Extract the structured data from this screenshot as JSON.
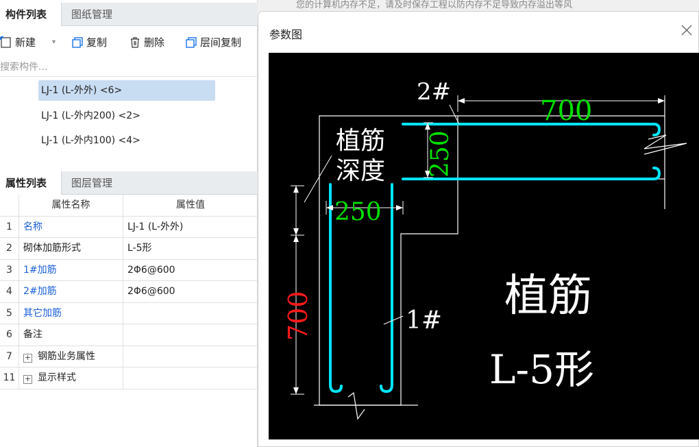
{
  "notice": "您的计算机内存不足，请及时保存工程以防内存不足导致内存溢出等风",
  "component_panel": {
    "tabs": [
      {
        "label": "构件列表",
        "active": true
      },
      {
        "label": "图纸管理",
        "active": false
      }
    ],
    "toolbar": {
      "new_label": "新建",
      "copy_label": "复制",
      "delete_label": "删除",
      "floor_copy_label": "层间复制"
    },
    "search_placeholder": "搜索构件...",
    "items": [
      {
        "label": "LJ-1 (L-外外)  <6>",
        "selected": true
      },
      {
        "label": "LJ-1 (L-外内200)  <2>",
        "selected": false
      },
      {
        "label": "LJ-1 (L-外内100)  <4>",
        "selected": false
      }
    ]
  },
  "property_panel": {
    "tabs": [
      {
        "label": "属性列表",
        "active": true
      },
      {
        "label": "图层管理",
        "active": false
      }
    ],
    "headers": {
      "name": "属性名称",
      "value": "属性值"
    },
    "rows": [
      {
        "num": "1",
        "name": "名称",
        "value": "LJ-1 (L-外外)",
        "blue": true
      },
      {
        "num": "2",
        "name": "砌体加筋形式",
        "value": "L-5形",
        "blue": false
      },
      {
        "num": "3",
        "name": "1#加筋",
        "value": "2Φ6@600",
        "blue": true
      },
      {
        "num": "4",
        "name": "2#加筋",
        "value": "2Φ6@600",
        "blue": true
      },
      {
        "num": "5",
        "name": "其它加筋",
        "value": "",
        "blue": true
      },
      {
        "num": "6",
        "name": "备注",
        "value": "",
        "blue": false
      },
      {
        "num": "7",
        "name": "钢筋业务属性",
        "value": "",
        "blue": false,
        "expandable": true
      },
      {
        "num": "11",
        "name": "显示样式",
        "value": "",
        "blue": false,
        "expandable": true
      }
    ]
  },
  "dialog": {
    "title": "参数图",
    "close_icon": "close-icon",
    "drawing": {
      "label_2": "2#",
      "label_1": "1#",
      "dim_top_length": "700",
      "dim_vertical_250": "250",
      "dim_horizontal_250": "250",
      "dim_left_length": "700",
      "embed_depth_line1": "植筋",
      "embed_depth_line2": "深度",
      "caption_line1": "植筋",
      "caption_line2": "L-5形",
      "colors": {
        "rebar": "#00e5ff",
        "dimension": "#00e000",
        "red_dimension": "#ff1a1a",
        "lines": "#ffffff"
      }
    }
  }
}
